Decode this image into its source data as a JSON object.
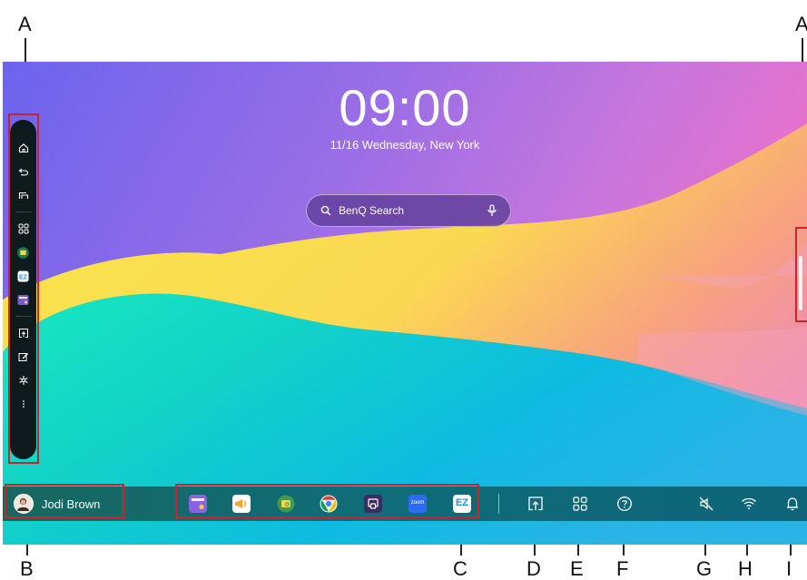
{
  "callouts": {
    "sidebar_left": "A",
    "sidebar_right": "A",
    "user": "B",
    "apps": "C",
    "share": "D",
    "all_apps": "E",
    "help": "F",
    "mute": "G",
    "wifi": "H",
    "notifications": "I"
  },
  "home": {
    "time": "09:00",
    "date_location": "11/16 Wednesday, New York",
    "search_placeholder": "BenQ Search"
  },
  "taskbar": {
    "user_name": "Jodi Brown",
    "zoom_label": "zoom",
    "ez_label": "EZ"
  },
  "colors": {
    "accent_red": "#c9252b",
    "taskbar": "#0e6579",
    "sidebar": "#0f1a1c"
  }
}
